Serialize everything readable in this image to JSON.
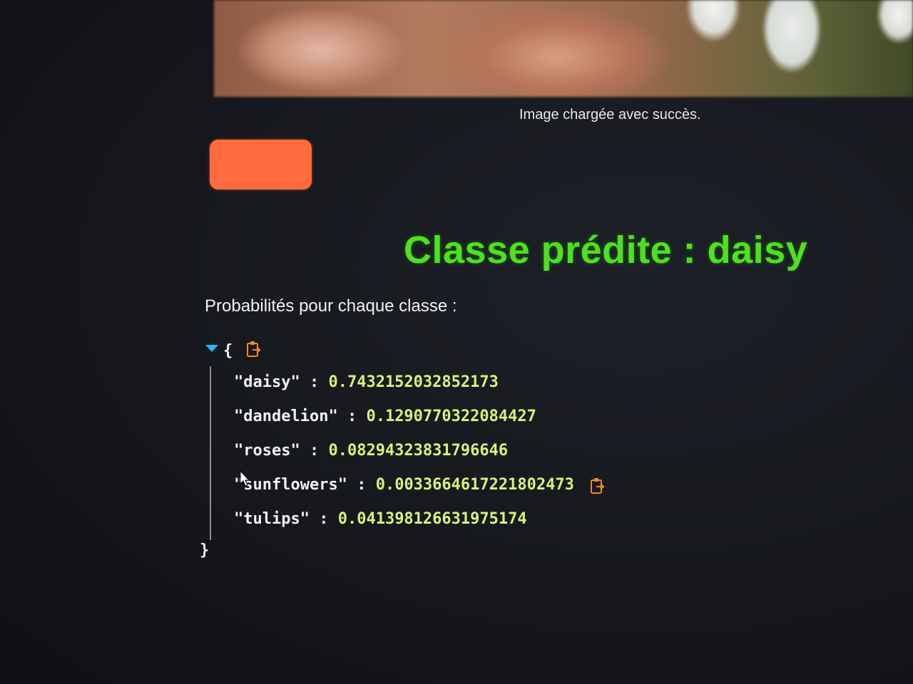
{
  "image": {
    "caption": "Image chargée avec succès."
  },
  "predict_button": {
    "label": ""
  },
  "prediction": {
    "title": "Classe prédite : daisy"
  },
  "probabilities": {
    "label": "Probabilités pour chaque classe :",
    "open_brace": "{",
    "close_brace": "}",
    "separator": " : ",
    "rows": [
      {
        "key": "\"daisy\"",
        "value": "0.7432152032852173"
      },
      {
        "key": "\"dandelion\"",
        "value": "0.1290770322084427"
      },
      {
        "key": "\"roses\"",
        "value": "0.08294323831796646"
      },
      {
        "key": "\"sunflowers\"",
        "value": "0.0033664617221802473"
      },
      {
        "key": "\"tulips\"",
        "value": "0.041398126631975174"
      }
    ]
  },
  "colors": {
    "accent_button": "#ff6b3d",
    "title_green": "#4de21f",
    "json_value": "#d9f27a",
    "caret_blue": "#29b6f6",
    "copy_icon": "#f08a24"
  },
  "icons": {
    "copy": "clipboard-copy-icon",
    "collapse": "caret-down-icon",
    "cursor": "mouse-pointer-icon"
  }
}
